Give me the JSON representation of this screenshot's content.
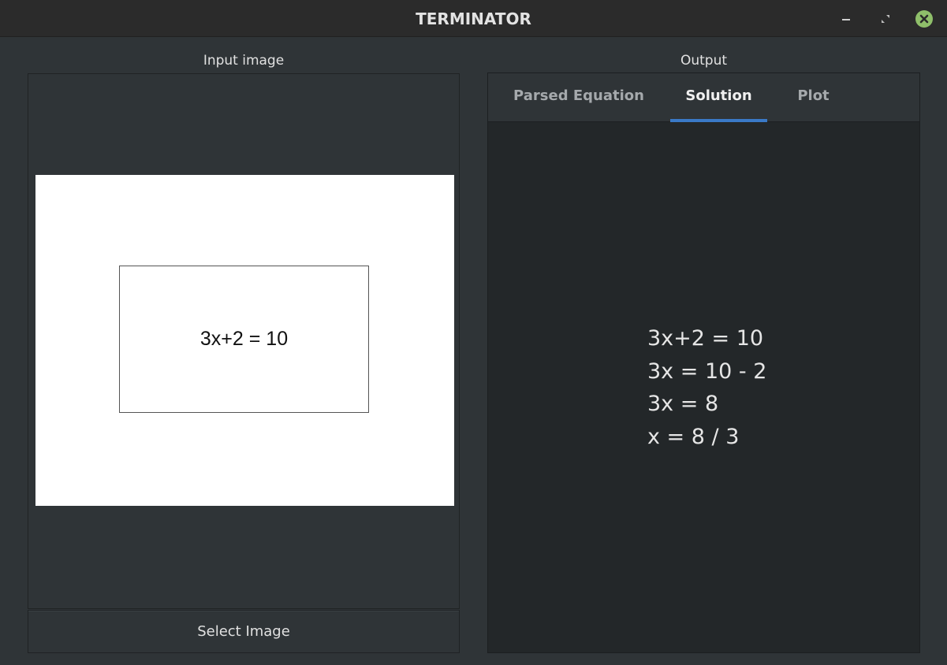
{
  "window": {
    "title": "TERMINATOR"
  },
  "input": {
    "label": "Input image",
    "image_equation": "3x+2 = 10",
    "select_button": "Select Image"
  },
  "output": {
    "label": "Output",
    "tabs": [
      {
        "label": "Parsed Equation",
        "active": false
      },
      {
        "label": "Solution",
        "active": true
      },
      {
        "label": "Plot",
        "active": false
      }
    ],
    "solution_lines": [
      "3x+2 = 10",
      "3x = 10 - 2",
      "3x = 8",
      "x = 8 / 3"
    ]
  },
  "colors": {
    "accent": "#3a79c7",
    "close_button": "#8fbf6a",
    "background": "#2f3437"
  },
  "icons": [
    "minimize-icon",
    "maximize-icon",
    "close-icon"
  ]
}
